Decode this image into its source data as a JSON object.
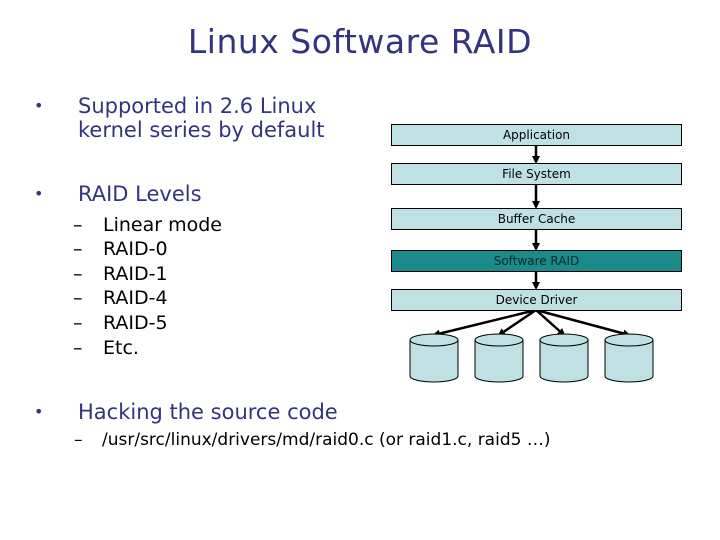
{
  "slide": {
    "title": "Linux Software RAID",
    "bullets": [
      {
        "text_line1": "Supported in 2.6 Linux",
        "text_line2": "kernel series by default"
      },
      {
        "text": "RAID Levels",
        "subitems": [
          "Linear mode",
          "RAID-0",
          "RAID-1",
          "RAID-4",
          "RAID-5",
          "Etc."
        ]
      },
      {
        "text": "Hacking the source code",
        "subitems": [
          "/usr/src/linux/drivers/md/raid0.c (or raid1.c, raid5 …)"
        ]
      }
    ],
    "bullet_glyph": "•",
    "dash_glyph": "–"
  },
  "diagram": {
    "layers": [
      {
        "label": "Application",
        "highlight": false
      },
      {
        "label": "File System",
        "highlight": false
      },
      {
        "label": "Buffer Cache",
        "highlight": false
      },
      {
        "label": "Software RAID",
        "highlight": true
      },
      {
        "label": "Device Driver",
        "highlight": false
      }
    ],
    "disk_count": 4,
    "colors": {
      "layer_fill": "#bfe1e4",
      "highlight_fill": "#1a8a8a",
      "disk_fill": "#bfe1e4",
      "title_color": "#333380"
    }
  }
}
